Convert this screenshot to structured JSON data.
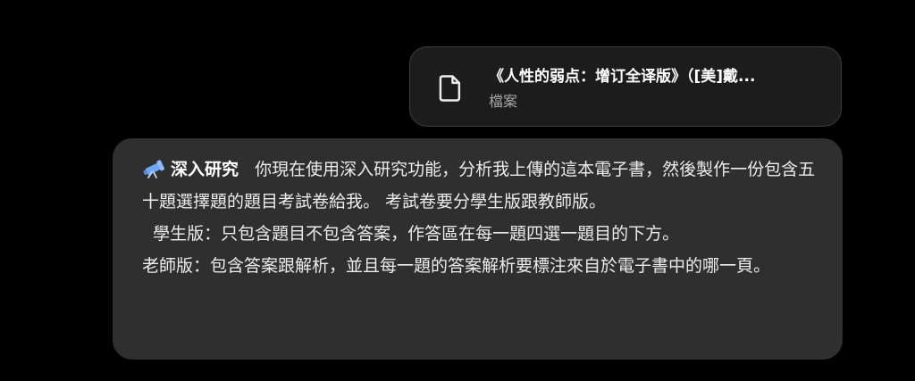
{
  "attachment": {
    "title": "《人性的弱点：增订全译版》（[美]戴...",
    "type_label": "檔案",
    "icon": "document-icon"
  },
  "message": {
    "tool_icon": "telescope-icon",
    "tool_label": "深入研究",
    "text": "你現在使用深入研究功能，分析我上傳的這本電子書，然後製作一份包含五十題選擇題的題目考試卷給我。 考試卷要分學生版跟教師版。\n  學生版：只包含題目不包含答案，作答區在每一題四選一題目的下方。\n老師版：包含答案跟解析，並且每一題的答案解析要標注來自於電子書中的哪一頁。",
    "colors": {
      "bubble": "#2f2f2f",
      "tool_icon_accent": "#6ea8fe"
    }
  }
}
